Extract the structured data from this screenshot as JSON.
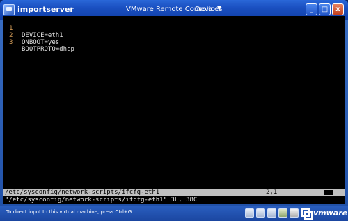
{
  "titlebar": {
    "vm_name": "importserver",
    "vm_name_arrow": "-",
    "console_title": "VMware Remote Console",
    "devices_menu": "Devices",
    "devices_arrow": "▼",
    "minimize": "_",
    "maximize": "□",
    "close": "x"
  },
  "editor": {
    "lines": [
      {
        "num": "1",
        "text": "DEVICE=eth1"
      },
      {
        "num": "2",
        "text": "ONBOOT=yes"
      },
      {
        "num": "3",
        "text": "BOOTPROTO=dhcp"
      }
    ],
    "status_path": "/etc/sysconfig/network-scripts/ifcfg-eth1",
    "status_position": "2,1",
    "command_line": "\"/etc/sysconfig/network-scripts/ifcfg-eth1\" 3L, 38C"
  },
  "bottombar": {
    "hint": "To direct input to this virtual machine, press Ctrl+G.",
    "device_icons": [
      "hard-disk-icon",
      "cdrom-icon",
      "floppy-icon",
      "network-icon",
      "usb-icon"
    ],
    "logo_text": "vmware"
  }
}
